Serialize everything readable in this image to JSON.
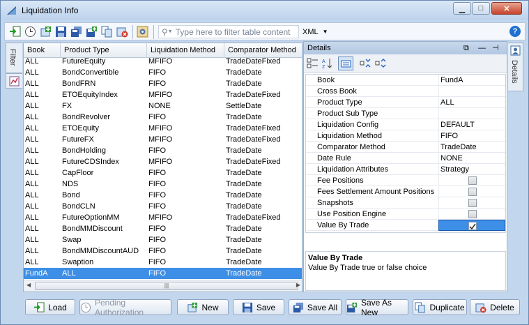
{
  "window": {
    "title": "Liquidation Info",
    "controls": [
      "minimize",
      "maximize",
      "close"
    ]
  },
  "toolbar": {
    "filter_placeholder": "Type here to filter table content",
    "format": "XML",
    "help": "?"
  },
  "left_tabs": {
    "filter": "Filter"
  },
  "right_tabs": {
    "details": "Details"
  },
  "grid": {
    "columns": [
      "Book",
      "Product Type",
      "Liquidation Method",
      "Comparator Method"
    ],
    "rows": [
      {
        "book": "ALL",
        "product": "FutureEquity",
        "method": "MFIFO",
        "comparator": "TradeDateFixed",
        "selected": false
      },
      {
        "book": "ALL",
        "product": "BondConvertible",
        "method": "FIFO",
        "comparator": "TradeDate",
        "selected": false
      },
      {
        "book": "ALL",
        "product": "BondFRN",
        "method": "FIFO",
        "comparator": "TradeDate",
        "selected": false
      },
      {
        "book": "ALL",
        "product": "ETOEquityIndex",
        "method": "MFIFO",
        "comparator": "TradeDateFixed",
        "selected": false
      },
      {
        "book": "ALL",
        "product": "FX",
        "method": "NONE",
        "comparator": "SettleDate",
        "selected": false
      },
      {
        "book": "ALL",
        "product": "BondRevolver",
        "method": "FIFO",
        "comparator": "TradeDate",
        "selected": false
      },
      {
        "book": "ALL",
        "product": "ETOEquity",
        "method": "MFIFO",
        "comparator": "TradeDateFixed",
        "selected": false
      },
      {
        "book": "ALL",
        "product": "FutureFX",
        "method": "MFIFO",
        "comparator": "TradeDateFixed",
        "selected": false
      },
      {
        "book": "ALL",
        "product": "BondHolding",
        "method": "FIFO",
        "comparator": "TradeDate",
        "selected": false
      },
      {
        "book": "ALL",
        "product": "FutureCDSIndex",
        "method": "MFIFO",
        "comparator": "TradeDateFixed",
        "selected": false
      },
      {
        "book": "ALL",
        "product": "CapFloor",
        "method": "FIFO",
        "comparator": "TradeDate",
        "selected": false
      },
      {
        "book": "ALL",
        "product": "NDS",
        "method": "FIFO",
        "comparator": "TradeDate",
        "selected": false
      },
      {
        "book": "ALL",
        "product": "Bond",
        "method": "FIFO",
        "comparator": "TradeDate",
        "selected": false
      },
      {
        "book": "ALL",
        "product": "BondCLN",
        "method": "FIFO",
        "comparator": "TradeDate",
        "selected": false
      },
      {
        "book": "ALL",
        "product": "FutureOptionMM",
        "method": "MFIFO",
        "comparator": "TradeDateFixed",
        "selected": false
      },
      {
        "book": "ALL",
        "product": "BondMMDiscount",
        "method": "FIFO",
        "comparator": "TradeDate",
        "selected": false
      },
      {
        "book": "ALL",
        "product": "Swap",
        "method": "FIFO",
        "comparator": "TradeDate",
        "selected": false
      },
      {
        "book": "ALL",
        "product": "BondMMDiscountAUD",
        "method": "FIFO",
        "comparator": "TradeDate",
        "selected": false
      },
      {
        "book": "ALL",
        "product": "Swaption",
        "method": "FIFO",
        "comparator": "TradeDate",
        "selected": false
      },
      {
        "book": "FundA",
        "product": "ALL",
        "method": "FIFO",
        "comparator": "TradeDate",
        "selected": true
      }
    ]
  },
  "details": {
    "title": "Details",
    "properties": [
      {
        "key": "Book",
        "value": "FundA",
        "type": "text"
      },
      {
        "key": "Cross Book",
        "value": "",
        "type": "text"
      },
      {
        "key": "Product Type",
        "value": "ALL",
        "type": "text"
      },
      {
        "key": "Product Sub Type",
        "value": "",
        "type": "text"
      },
      {
        "key": "Liquidation Config",
        "value": "DEFAULT",
        "type": "text"
      },
      {
        "key": "Liquidation Method",
        "value": "FIFO",
        "type": "text"
      },
      {
        "key": "Comparator Method",
        "value": "TradeDate",
        "type": "text"
      },
      {
        "key": "Date Rule",
        "value": "NONE",
        "type": "text"
      },
      {
        "key": "Liquidation Attributes",
        "value": "Strategy",
        "type": "text"
      },
      {
        "key": "Fee Positions",
        "value": "",
        "type": "check",
        "checked": false
      },
      {
        "key": "Fees Settlement Amount Positions",
        "value": "",
        "type": "check",
        "checked": false
      },
      {
        "key": "Snapshots",
        "value": "",
        "type": "check",
        "checked": false
      },
      {
        "key": "Use Position Engine",
        "value": "",
        "type": "check",
        "checked": false
      },
      {
        "key": "Value By Trade",
        "value": "",
        "type": "check",
        "checked": true,
        "selected": true
      }
    ],
    "desc_title": "Value By Trade",
    "desc_text": "Value By Trade true or false choice"
  },
  "buttons": {
    "load": "Load",
    "pending": "Pending Authorization",
    "new": "New",
    "save": "Save",
    "save_all": "Save All",
    "save_as_new": "Save As New",
    "duplicate": "Duplicate",
    "delete": "Delete"
  },
  "colors": {
    "selection": "#3d8ee6",
    "frame": "#c2d7ee",
    "accent": "#1f6fd0"
  }
}
